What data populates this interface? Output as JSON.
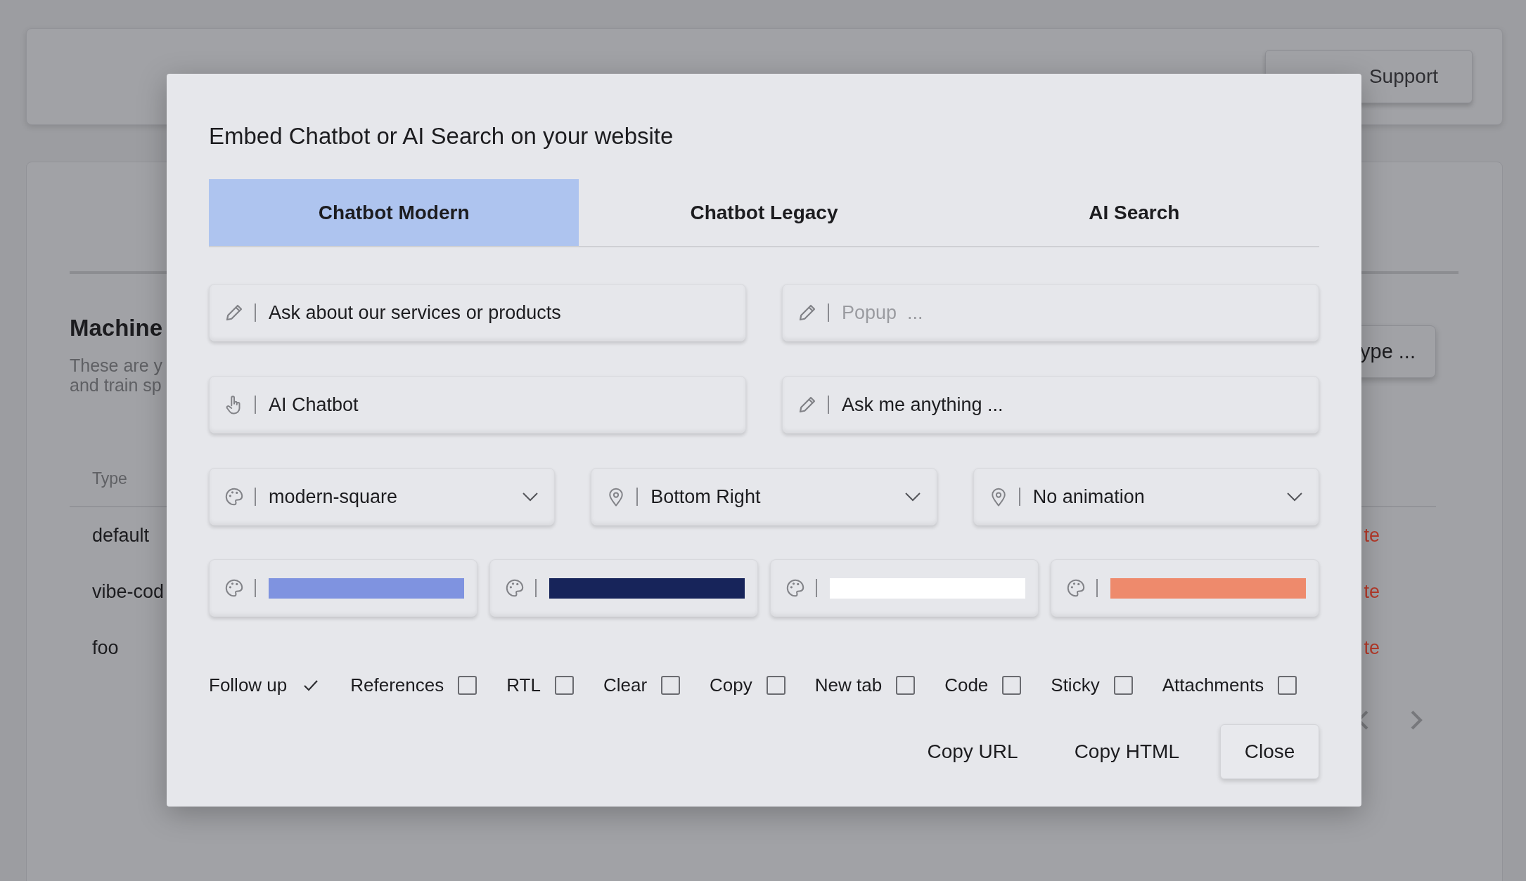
{
  "background": {
    "header": {
      "support_button": "Support"
    },
    "section": {
      "title": "Machine",
      "description_lines": [
        "These are y",
        "and train sp"
      ],
      "type_button": "ype ...",
      "table": {
        "column": "Type",
        "rows": [
          {
            "type": "default",
            "action": "te"
          },
          {
            "type": "vibe-cod",
            "action": "te"
          },
          {
            "type": "foo",
            "action": "te"
          }
        ]
      }
    }
  },
  "modal": {
    "title": "Embed Chatbot or AI Search on your website",
    "tabs": [
      {
        "label": "Chatbot Modern",
        "selected": true
      },
      {
        "label": "Chatbot Legacy",
        "selected": false
      },
      {
        "label": "AI Search",
        "selected": false
      }
    ],
    "fields": [
      {
        "kind": "text",
        "value": "Ask about our services or products"
      },
      {
        "kind": "text",
        "placeholder": "Popup  ..."
      },
      {
        "kind": "button-label",
        "value": "AI Chatbot"
      },
      {
        "kind": "text",
        "value": "Ask me anything ..."
      }
    ],
    "selects": [
      {
        "kind": "theme",
        "value": "modern-square"
      },
      {
        "kind": "position",
        "value": "Bottom Right"
      },
      {
        "kind": "position",
        "value": "No animation"
      }
    ],
    "colors": [
      {
        "color": "#7f93e0"
      },
      {
        "color": "#17245a"
      },
      {
        "color": "#ffffff"
      },
      {
        "color": "#ee8a6c"
      }
    ],
    "options": [
      {
        "label": "Follow up",
        "checked": true
      },
      {
        "label": "References",
        "checked": false
      },
      {
        "label": "RTL",
        "checked": false
      },
      {
        "label": "Clear",
        "checked": false
      },
      {
        "label": "Copy",
        "checked": false
      },
      {
        "label": "New tab",
        "checked": false
      },
      {
        "label": "Code",
        "checked": false
      },
      {
        "label": "Sticky",
        "checked": false
      },
      {
        "label": "Attachments",
        "checked": false
      }
    ],
    "buttons": [
      {
        "label": "Copy URL",
        "kind": "plain"
      },
      {
        "label": "Copy HTML",
        "kind": "plain"
      },
      {
        "label": "Close",
        "kind": "outlined"
      }
    ]
  }
}
